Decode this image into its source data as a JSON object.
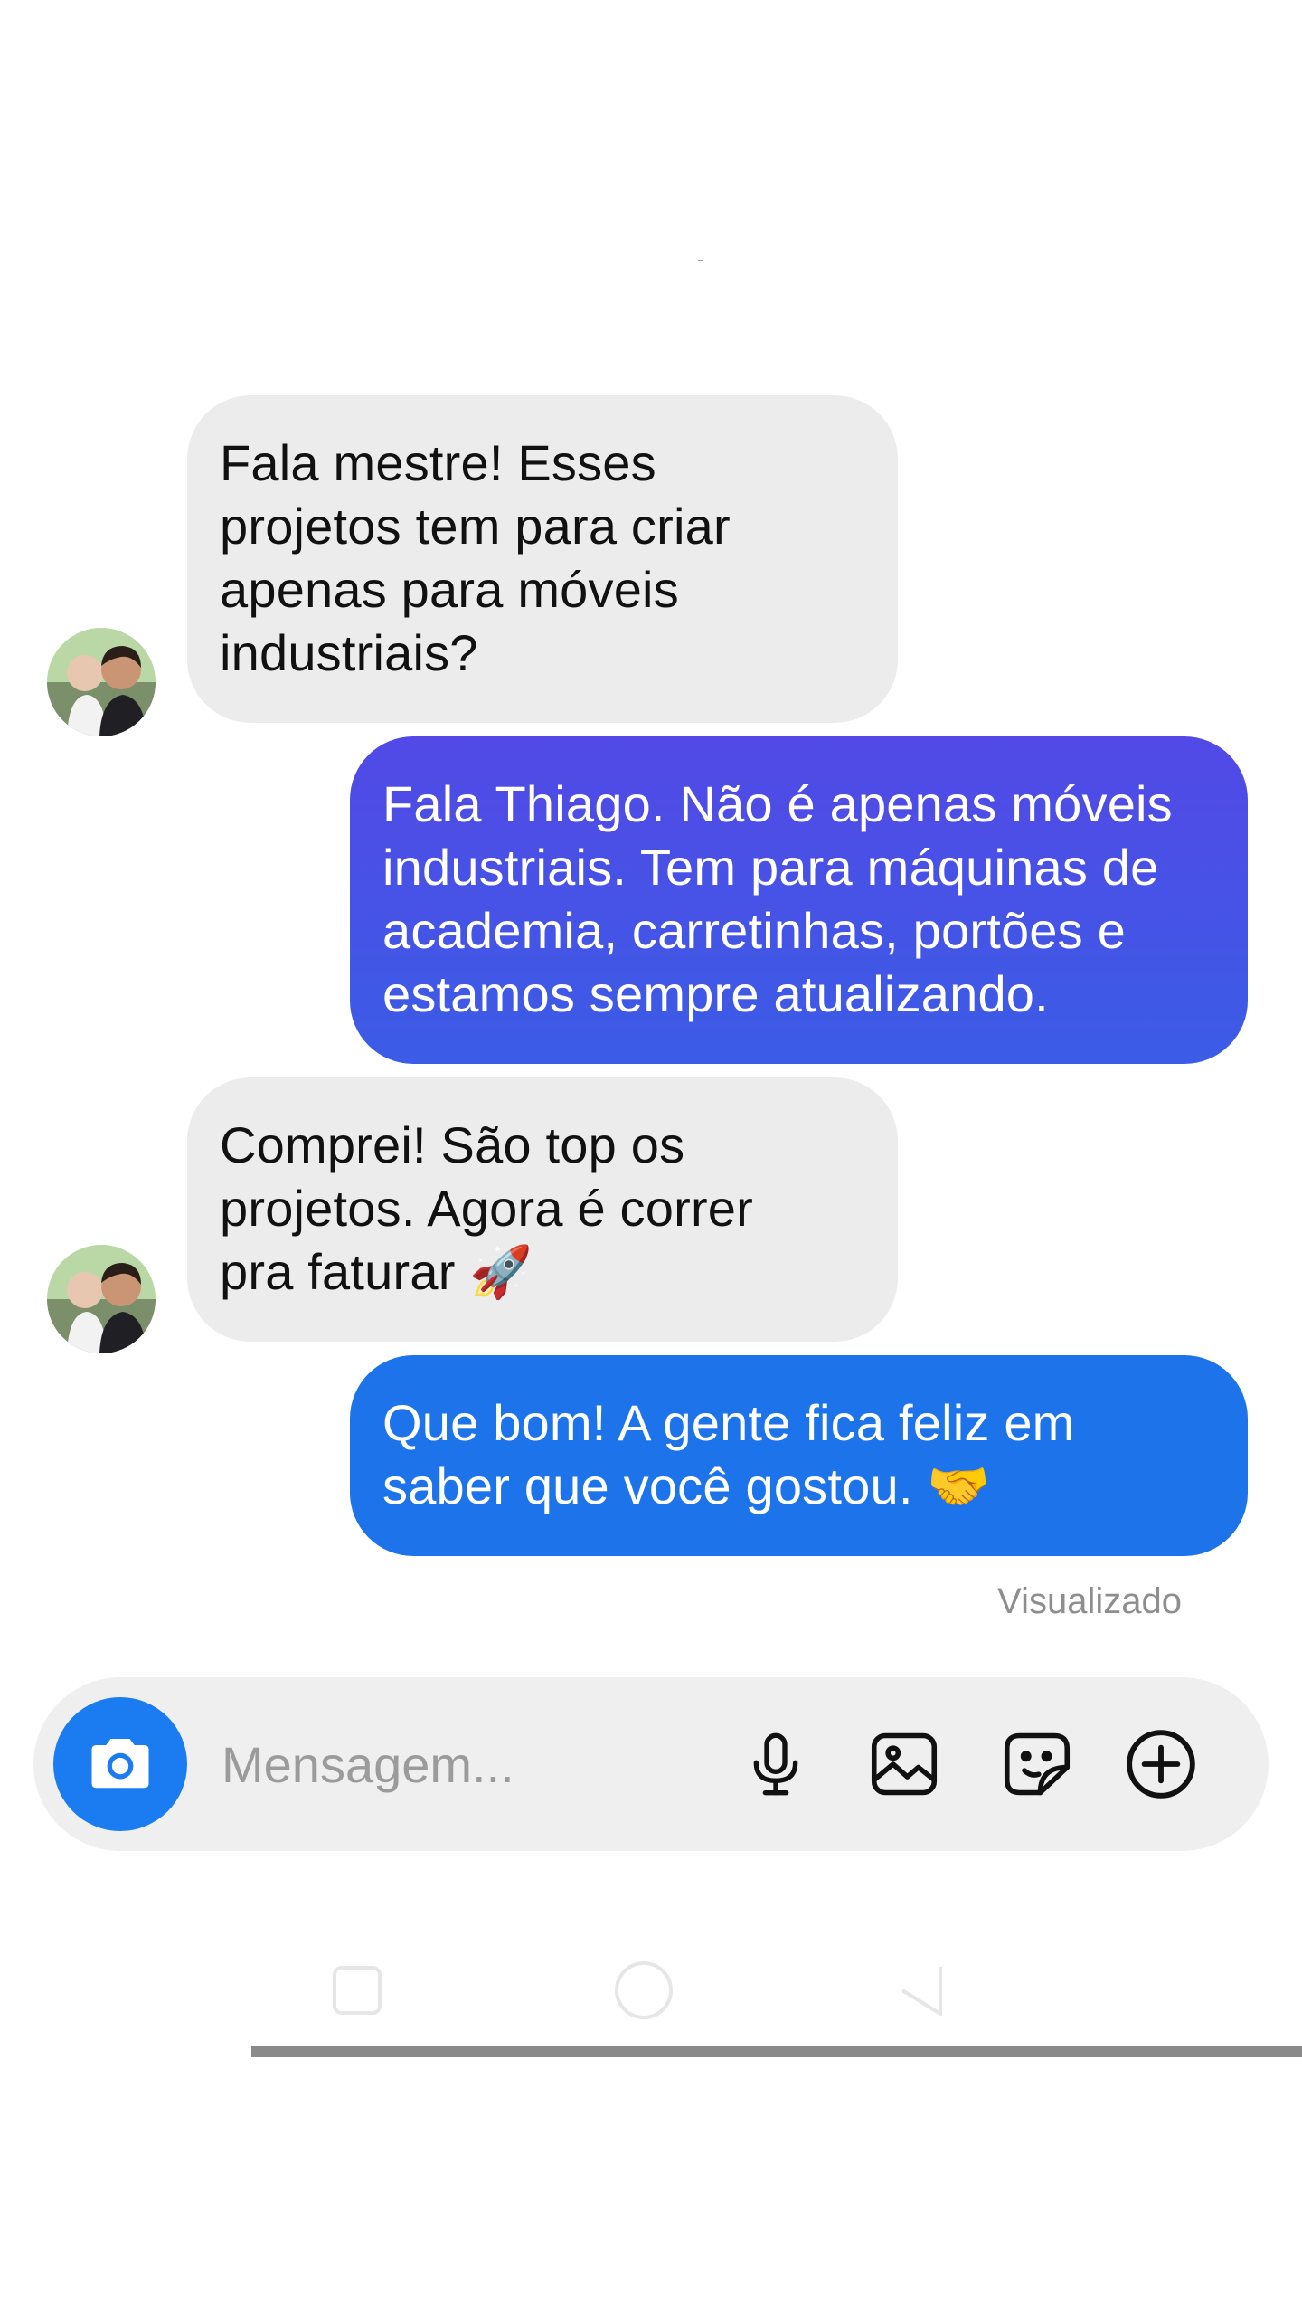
{
  "conversation": {
    "messages": [
      {
        "sender": "other",
        "lines": [
          "Fala mestre! Esses",
          "projetos tem para criar",
          "apenas para móveis",
          "industriais?"
        ]
      },
      {
        "sender": "me",
        "lines": [
          "Fala Thiago. Não é apenas móveis",
          "industriais. Tem para máquinas de",
          "academia, carretinhas, portões e",
          "estamos sempre atualizando."
        ]
      },
      {
        "sender": "other",
        "lines": [
          "Comprei! São top os",
          "projetos. Agora é correr",
          "pra faturar"
        ],
        "emoji": "🚀"
      },
      {
        "sender": "me",
        "lines": [
          "Que bom! A gente fica feliz em",
          "saber que você gostou."
        ],
        "emoji": "🤝"
      }
    ],
    "seen_label": "Visualizado"
  },
  "composer": {
    "placeholder": "Mensagem...",
    "buttons": [
      "camera-icon",
      "microphone-icon",
      "gallery-icon",
      "sticker-icon",
      "plus-icon"
    ]
  },
  "colors": {
    "incoming_bubble": "#ececec",
    "outgoing_gradient_top": "#5249e6",
    "outgoing_gradient_bottom": "#3b5ce6",
    "outgoing_bubble_2": "#1d73ea",
    "accent": "#1a7cf0"
  }
}
